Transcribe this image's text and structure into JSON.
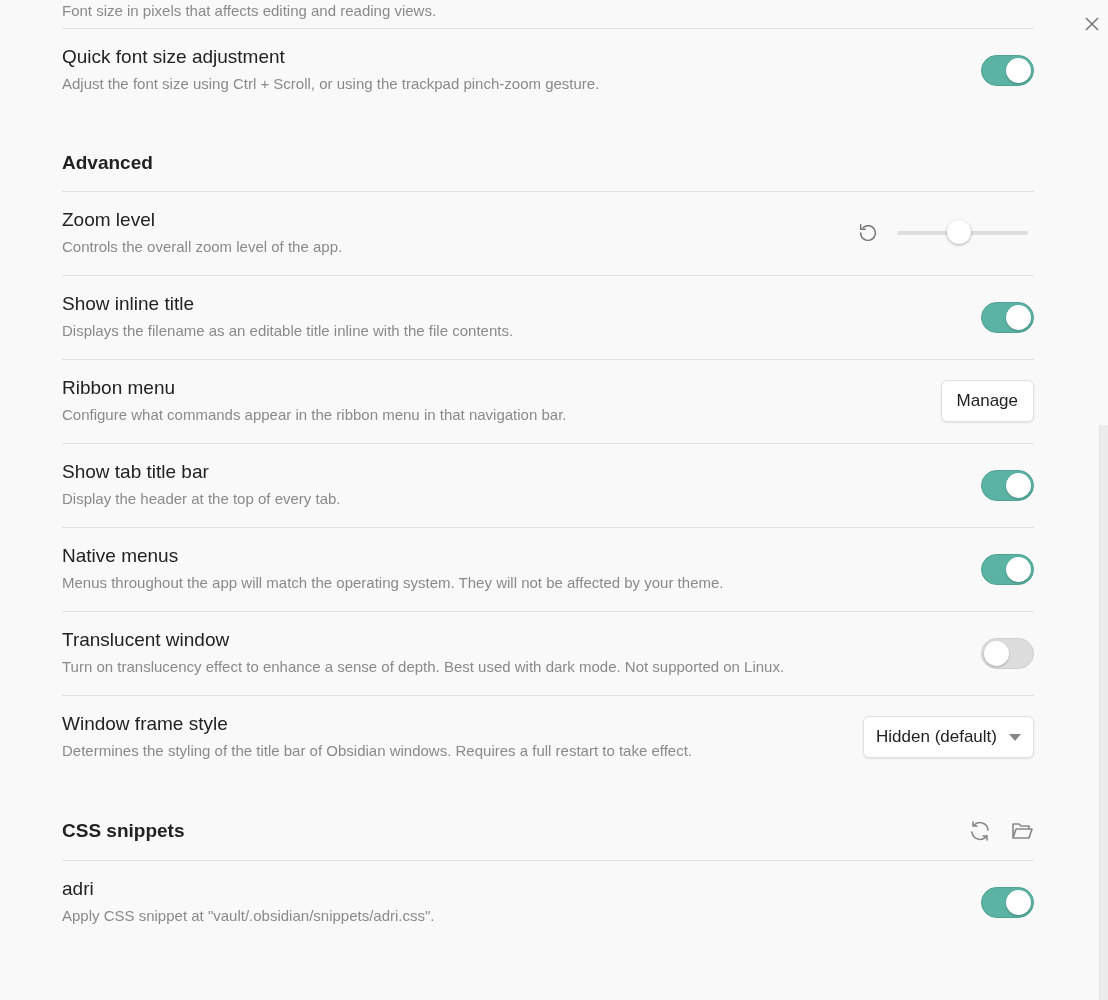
{
  "top_description": "Font size in pixels that affects editing and reading views.",
  "sections": [
    {
      "items": [
        {
          "kind": "toggle",
          "title": "Quick font size adjustment",
          "description": "Adjust the font size using Ctrl + Scroll, or using the trackpad pinch-zoom gesture.",
          "on": true
        }
      ]
    },
    {
      "heading": "Advanced",
      "items": [
        {
          "kind": "slider",
          "title": "Zoom level",
          "description": "Controls the overall zoom level of the app.",
          "level": 0.47
        },
        {
          "kind": "toggle",
          "title": "Show inline title",
          "description": "Displays the filename as an editable title inline with the file contents.",
          "on": true
        },
        {
          "kind": "button",
          "title": "Ribbon menu",
          "description": "Configure what commands appear in the ribbon menu in that navigation bar.",
          "button": "Manage"
        },
        {
          "kind": "toggle",
          "title": "Show tab title bar",
          "description": "Display the header at the top of every tab.",
          "on": true
        },
        {
          "kind": "toggle",
          "title": "Native menus",
          "description": "Menus throughout the app will match the operating system. They will not be affected by your theme.",
          "on": true
        },
        {
          "kind": "toggle",
          "title": "Translucent window",
          "description": "Turn on translucency effect to enhance a sense of depth. Best used with dark mode. Not supported on Linux.",
          "on": false
        },
        {
          "kind": "dropdown",
          "title": "Window frame style",
          "description": "Determines the styling of the title bar of Obsidian windows. Requires a full restart to take effect.",
          "value": "Hidden (default)"
        }
      ]
    },
    {
      "heading": "CSS snippets",
      "heading_actions": [
        {
          "kind": "reload"
        },
        {
          "kind": "folder"
        }
      ],
      "items": [
        {
          "kind": "toggle",
          "title": "adri",
          "description": "Apply CSS snippet at \"vault/.obsidian/snippets/adri.css\".",
          "on": true
        }
      ]
    }
  ]
}
